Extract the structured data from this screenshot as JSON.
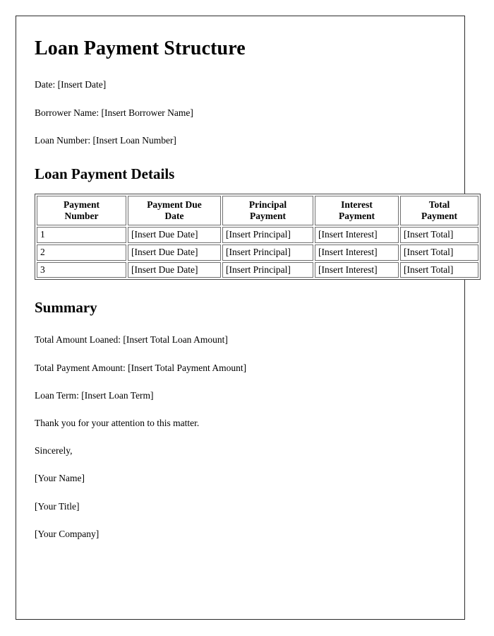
{
  "document": {
    "title": "Loan Payment Structure",
    "header_fields": [
      "Date: [Insert Date]",
      "Borrower Name: [Insert Borrower Name]",
      "Loan Number: [Insert Loan Number]"
    ],
    "details_section": {
      "heading": "Loan Payment Details",
      "table": {
        "columns": [
          "Payment Number",
          "Payment Due Date",
          "Principal Payment",
          "Interest Payment",
          "Total Payment"
        ],
        "column_lines": [
          [
            "Payment",
            "Number"
          ],
          [
            "Payment Due",
            "Date"
          ],
          [
            "Principal",
            "Payment"
          ],
          [
            "Interest",
            "Payment"
          ],
          [
            "Total",
            "Payment"
          ]
        ],
        "rows": [
          [
            "1",
            "[Insert Due Date]",
            "[Insert Principal]",
            "[Insert Interest]",
            "[Insert Total]"
          ],
          [
            "2",
            "[Insert Due Date]",
            "[Insert Principal]",
            "[Insert Interest]",
            "[Insert Total]"
          ],
          [
            "3",
            "[Insert Due Date]",
            "[Insert Principal]",
            "[Insert Interest]",
            "[Insert Total]"
          ]
        ]
      }
    },
    "summary_section": {
      "heading": "Summary",
      "lines": [
        "Total Amount Loaned: [Insert Total Loan Amount]",
        "Total Payment Amount: [Insert Total Payment Amount]",
        "Loan Term: [Insert Loan Term]",
        "Thank you for your attention to this matter.",
        "Sincerely,",
        "[Your Name]",
        "[Your Title]",
        "[Your Company]"
      ]
    }
  },
  "colors": {
    "page_background": "#ffffff",
    "text": "#000000",
    "page_border": "#2b2b2b",
    "table_border": "#6f6f6f"
  }
}
